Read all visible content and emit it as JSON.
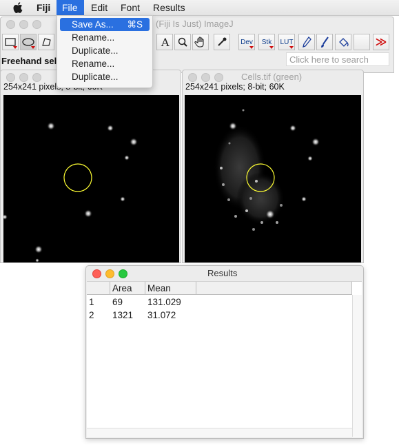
{
  "menubar": {
    "app": "Fiji",
    "items": [
      "File",
      "Edit",
      "Font",
      "Results"
    ]
  },
  "file_menu": {
    "items": [
      {
        "label": "Save As...",
        "shortcut": "⌘S"
      },
      {
        "label": "Rename..."
      },
      {
        "label": "Duplicate..."
      },
      {
        "label": "Rename..."
      },
      {
        "label": "Duplicate..."
      }
    ]
  },
  "fiji_window": {
    "title": "(Fiji Is Just) ImageJ",
    "status": "Freehand sele",
    "search_placeholder": "Click here to search",
    "toolbar": {
      "dev": "Dev",
      "stk": "Stk",
      "lut": "LUT",
      "more": "≫"
    }
  },
  "image_left": {
    "title": "",
    "info": "254x241 pixels; 8-bit; 60K"
  },
  "image_right": {
    "title": "Cells.tif (green)",
    "info": "254x241 pixels; 8-bit; 60K"
  },
  "results": {
    "title": "Results",
    "columns": [
      "",
      "Area",
      "Mean"
    ],
    "rows": [
      [
        "1",
        "69",
        "131.029"
      ],
      [
        "2",
        "1321",
        "31.072"
      ]
    ]
  },
  "colors": {
    "menu_highlight": "#2a70e0",
    "selection_roi": "#ffff33",
    "traffic_red": "#fe5f57",
    "traffic_yellow": "#febc2e",
    "traffic_green": "#28c840"
  }
}
